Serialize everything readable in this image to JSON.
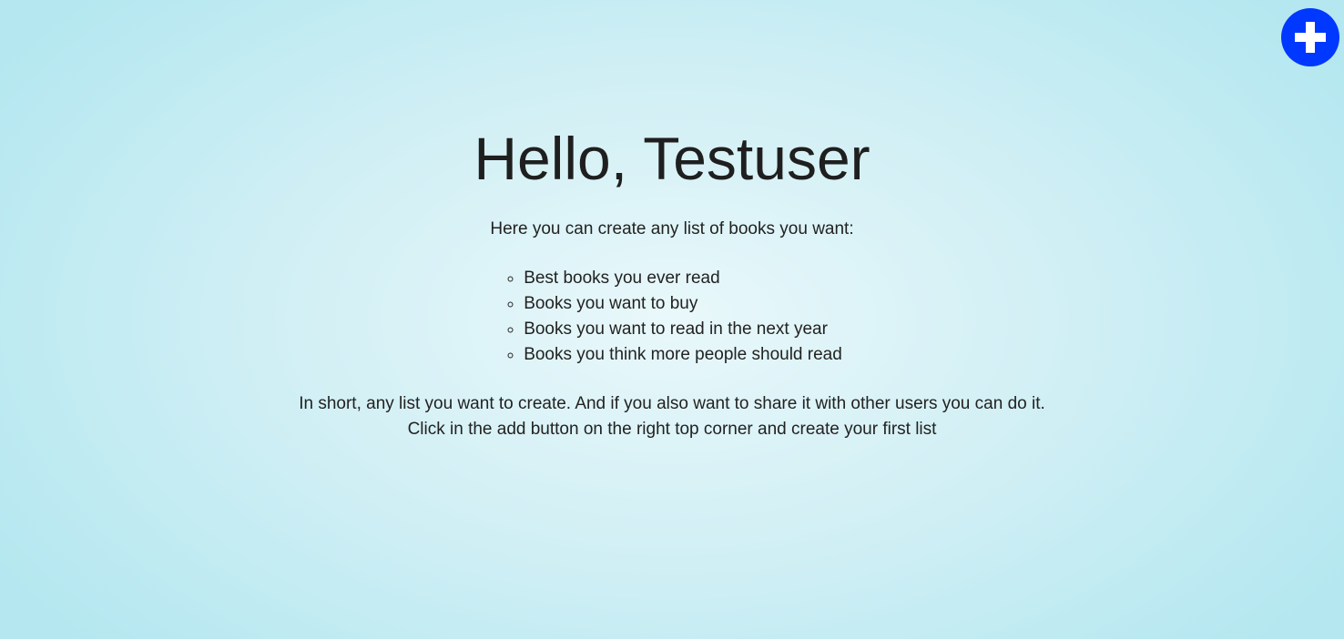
{
  "header": {
    "add_button_icon": "plus-icon",
    "accent_color": "#0038ff"
  },
  "main": {
    "greeting": "Hello, Testuser",
    "intro": "Here you can create any list of books you want:",
    "examples": [
      "Best books you ever read",
      "Books you want to buy",
      "Books you want to read in the next year",
      "Books you think more people should read"
    ],
    "outro_line1": "In short, any list you want to create. And if you also want to share it with other users you can do it.",
    "outro_line2": "Click in the add button on the right top corner and create your first list"
  }
}
